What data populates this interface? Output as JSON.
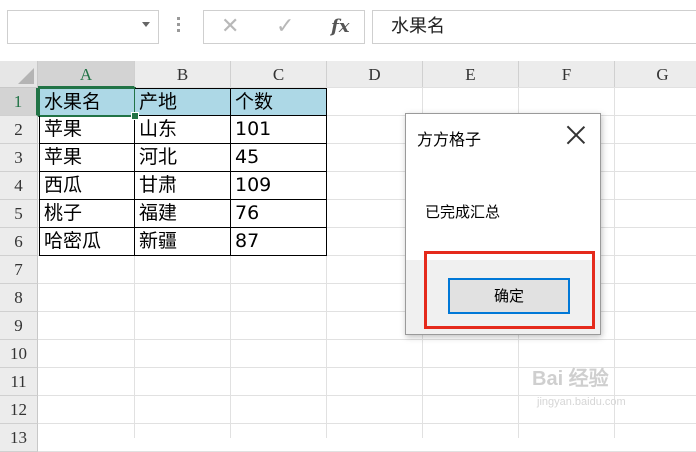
{
  "formula_bar": {
    "name_box": "",
    "cancel_symbol": "✕",
    "enter_symbol": "✓",
    "fx_label": "fx",
    "content": "水果名"
  },
  "columns": [
    "A",
    "B",
    "C",
    "D",
    "E",
    "F",
    "G"
  ],
  "rows": [
    "1",
    "2",
    "3",
    "4",
    "5",
    "6",
    "7",
    "8",
    "9",
    "10",
    "11",
    "12",
    "13"
  ],
  "table": {
    "header": [
      "水果名",
      "产地",
      "个数"
    ],
    "rows": [
      [
        "苹果",
        "山东",
        "101"
      ],
      [
        "苹果",
        "河北",
        "45"
      ],
      [
        "西瓜",
        "甘肃",
        "109"
      ],
      [
        "桃子",
        "福建",
        "76"
      ],
      [
        "哈密瓜",
        "新疆",
        "87"
      ]
    ]
  },
  "dialog": {
    "title": "方方格子",
    "message": "已完成汇总",
    "ok_label": "确定"
  },
  "colors": {
    "header_fill": "#add8e6",
    "selection": "#217346",
    "highlight_box": "#e52a1c",
    "button_focus": "#0078d7"
  },
  "watermark": {
    "text": "Bai 经验",
    "url": "jingyan.baidu.com"
  }
}
